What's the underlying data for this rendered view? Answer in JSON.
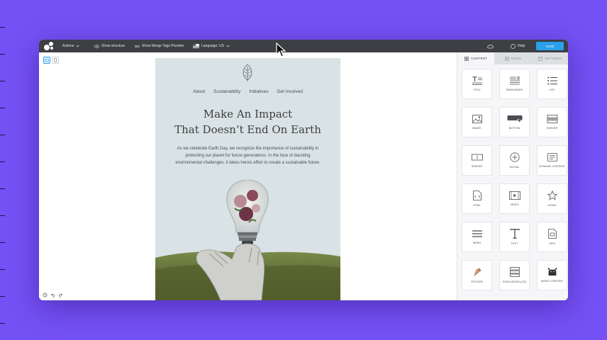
{
  "app": {
    "toolbar": {
      "actions_label": "Actions",
      "show_structure_label": "Show structure",
      "merge_tags_label": "Show Merge Tags Preview",
      "language_label": "Language: US",
      "help_label": "Help",
      "save_label": "SAVE"
    },
    "panel": {
      "tabs": [
        {
          "label": "CONTENT"
        },
        {
          "label": "ROWS"
        },
        {
          "label": "SETTINGS"
        }
      ],
      "tiles": [
        {
          "label": "TITLE",
          "icon": "title-icon"
        },
        {
          "label": "PARAGRAPH",
          "icon": "paragraph-icon"
        },
        {
          "label": "LIST",
          "icon": "list-icon"
        },
        {
          "label": "IMAGE",
          "icon": "image-icon"
        },
        {
          "label": "BUTTON",
          "icon": "button-icon"
        },
        {
          "label": "DIVIDER",
          "icon": "divider-icon"
        },
        {
          "label": "SPACER",
          "icon": "spacer-icon"
        },
        {
          "label": "SOCIAL",
          "icon": "social-icon"
        },
        {
          "label": "DYNAMIC CONTENT",
          "icon": "dynamic-content-icon"
        },
        {
          "label": "HTML",
          "icon": "html-icon"
        },
        {
          "label": "VIDEO",
          "icon": "video-icon"
        },
        {
          "label": "ICONS",
          "icon": "star-icon"
        },
        {
          "label": "MENU",
          "icon": "menu-icon"
        },
        {
          "label": "TEXT",
          "icon": "text-icon"
        },
        {
          "label": "GIFS",
          "icon": "gif-icon"
        },
        {
          "label": "STICKER",
          "icon": "sticker-icon"
        },
        {
          "label": "ROW ADDON (CD)",
          "icon": "row-addon-icon"
        },
        {
          "label": "MIXED CONTENT",
          "icon": "mixed-content-icon"
        }
      ]
    }
  },
  "email": {
    "nav": [
      "About",
      "Sustainability",
      "Initiatives",
      "Get Involved"
    ],
    "headline_line1": "Make An Impact",
    "headline_line2": "That Doesn’t End On Earth",
    "body": "As we celebrate Earth Day, we recognize the importance of sustainability in protecting our planet for future generations. In the face of daunting environmental challenges, it takes heroic effort to create a sustainable future."
  },
  "colors": {
    "background": "#7451f4",
    "toolbar": "#3d3f44",
    "save_button": "#2aa0ea",
    "email_bg": "#d9e2e4"
  }
}
